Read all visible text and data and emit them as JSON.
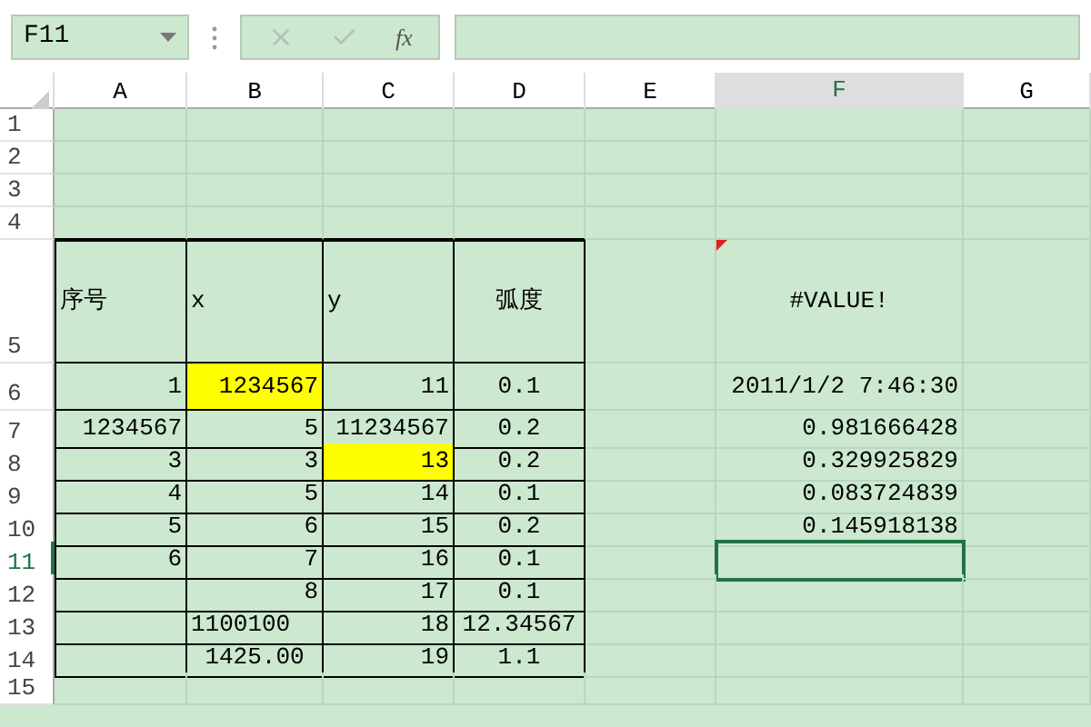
{
  "formula_bar": {
    "name_box": "F11",
    "function_button": "fx",
    "cancel_disabled": true,
    "confirm_disabled": true
  },
  "columns": [
    {
      "label": "A",
      "selected": false
    },
    {
      "label": "B",
      "selected": false
    },
    {
      "label": "C",
      "selected": false
    },
    {
      "label": "D",
      "selected": false
    },
    {
      "label": "E",
      "selected": false
    },
    {
      "label": "F",
      "selected": true
    },
    {
      "label": "G",
      "selected": false
    }
  ],
  "rows": [
    {
      "header": "1",
      "selected": false,
      "cells": [
        {},
        {},
        {},
        {},
        {},
        {},
        {}
      ]
    },
    {
      "header": "2",
      "selected": false,
      "cells": [
        {},
        {},
        {},
        {},
        {},
        {},
        {}
      ]
    },
    {
      "header": "3",
      "selected": false,
      "cells": [
        {},
        {},
        {},
        {},
        {},
        {},
        {}
      ]
    },
    {
      "header": "4",
      "selected": false,
      "cells": [
        {},
        {},
        {},
        {},
        {},
        {},
        {}
      ]
    },
    {
      "header": "5",
      "selected": false,
      "cells": [
        {
          "text": "序号",
          "kind": "label",
          "bordered": true
        },
        {
          "text": "x",
          "kind": "label",
          "bordered": true
        },
        {
          "text": "y",
          "kind": "label",
          "bordered": true
        },
        {
          "text": "弧度",
          "kind": "centered",
          "bordered": true
        },
        {},
        {
          "text": "#VALUE!",
          "kind": "centered",
          "comment": true
        },
        {}
      ]
    },
    {
      "header": "6",
      "selected": false,
      "cells": [
        {
          "text": "1",
          "kind": "number",
          "bordered": true
        },
        {
          "text": "1234567",
          "kind": "number",
          "bordered": true,
          "highlighted": true
        },
        {
          "text": "11",
          "kind": "number",
          "bordered": true
        },
        {
          "text": "0.1",
          "kind": "centered",
          "bordered": true
        },
        {},
        {
          "text": "2011/1/2 7:46:30",
          "kind": "number"
        },
        {}
      ]
    },
    {
      "header": "7",
      "selected": false,
      "cells": [
        {
          "text": "1234567",
          "kind": "number",
          "bordered": true
        },
        {
          "text": "5",
          "kind": "number",
          "bordered": true
        },
        {
          "text": "11234567",
          "kind": "number",
          "bordered": true
        },
        {
          "text": "0.2",
          "kind": "centered",
          "bordered": true
        },
        {},
        {
          "text": "0.981666428",
          "kind": "number"
        },
        {}
      ]
    },
    {
      "header": "8",
      "selected": false,
      "cells": [
        {
          "text": "3",
          "kind": "number",
          "bordered": true
        },
        {
          "text": "3",
          "kind": "number",
          "bordered": true
        },
        {
          "text": "13",
          "kind": "number",
          "bordered": true,
          "highlighted": true
        },
        {
          "text": "0.2",
          "kind": "centered",
          "bordered": true
        },
        {},
        {
          "text": "0.329925829",
          "kind": "number"
        },
        {}
      ]
    },
    {
      "header": "9",
      "selected": false,
      "cells": [
        {
          "text": "4",
          "kind": "number",
          "bordered": true
        },
        {
          "text": "5",
          "kind": "number",
          "bordered": true
        },
        {
          "text": "14",
          "kind": "number",
          "bordered": true
        },
        {
          "text": "0.1",
          "kind": "centered",
          "bordered": true
        },
        {},
        {
          "text": "0.083724839",
          "kind": "number"
        },
        {}
      ]
    },
    {
      "header": "10",
      "selected": false,
      "cells": [
        {
          "text": "5",
          "kind": "number",
          "bordered": true
        },
        {
          "text": "6",
          "kind": "number",
          "bordered": true
        },
        {
          "text": "15",
          "kind": "number",
          "bordered": true
        },
        {
          "text": "0.2",
          "kind": "centered",
          "bordered": true
        },
        {},
        {
          "text": "0.145918138",
          "kind": "number"
        },
        {}
      ]
    },
    {
      "header": "11",
      "selected": true,
      "cells": [
        {
          "text": "6",
          "kind": "number",
          "bordered": true
        },
        {
          "text": "7",
          "kind": "number",
          "bordered": true
        },
        {
          "text": "16",
          "kind": "number",
          "bordered": true
        },
        {
          "text": "0.1",
          "kind": "centered",
          "bordered": true
        },
        {},
        {},
        {}
      ]
    },
    {
      "header": "12",
      "selected": false,
      "cells": [
        {
          "bordered": true
        },
        {
          "text": "8",
          "kind": "number",
          "bordered": true
        },
        {
          "text": "17",
          "kind": "number",
          "bordered": true
        },
        {
          "text": "0.1",
          "kind": "centered",
          "bordered": true
        },
        {},
        {},
        {}
      ]
    },
    {
      "header": "13",
      "selected": false,
      "cells": [
        {
          "bordered": true
        },
        {
          "text": "1100100",
          "kind": "label",
          "bordered": true
        },
        {
          "text": "18",
          "kind": "number",
          "bordered": true
        },
        {
          "text": "12.34567",
          "kind": "centered",
          "bordered": true
        },
        {},
        {},
        {}
      ]
    },
    {
      "header": "14",
      "selected": false,
      "cells": [
        {
          "bordered": true
        },
        {
          "text": "1425.00",
          "kind": "centered",
          "bordered": true
        },
        {
          "text": "19",
          "kind": "number",
          "bordered": true
        },
        {
          "text": "1.1",
          "kind": "centered",
          "bordered": true
        },
        {},
        {},
        {}
      ]
    },
    {
      "header": "15",
      "selected": false,
      "cells": [
        {},
        {},
        {},
        {},
        {},
        {},
        {}
      ]
    }
  ]
}
